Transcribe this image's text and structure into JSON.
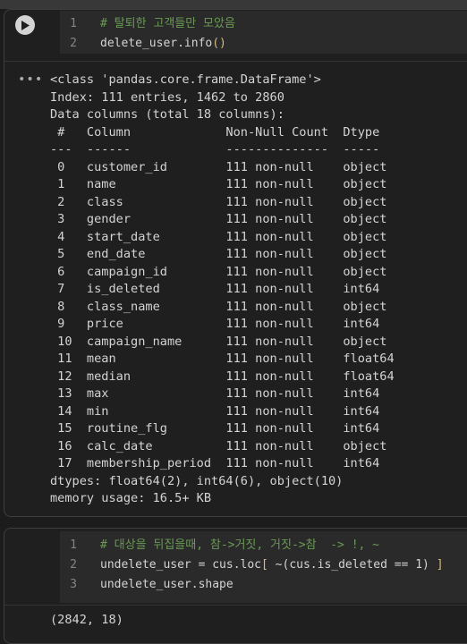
{
  "cell1": {
    "code_lines": [
      {
        "num": "1",
        "text": "# 탈퇴한 고객들만 모았음"
      },
      {
        "num": "2",
        "text_a": "delete_user.info",
        "text_b": "()"
      }
    ],
    "output_menu": "•••",
    "output_lines": [
      "<class 'pandas.core.frame.DataFrame'>",
      "Index: 111 entries, 1462 to 2860",
      "Data columns (total 18 columns):",
      " #   Column             Non-Null Count  Dtype ",
      "---  ------             --------------  ----- ",
      " 0   customer_id        111 non-null    object",
      " 1   name               111 non-null    object",
      " 2   class              111 non-null    object",
      " 3   gender             111 non-null    object",
      " 4   start_date         111 non-null    object",
      " 5   end_date           111 non-null    object",
      " 6   campaign_id        111 non-null    object",
      " 7   is_deleted         111 non-null    int64 ",
      " 8   class_name         111 non-null    object",
      " 9   price              111 non-null    int64 ",
      " 10  campaign_name      111 non-null    object",
      " 11  mean               111 non-null    float64",
      " 12  median             111 non-null    float64",
      " 13  max                111 non-null    int64 ",
      " 14  min                111 non-null    int64 ",
      " 15  routine_flg        111 non-null    int64 ",
      " 16  calc_date          111 non-null    object",
      " 17  membership_period  111 non-null    int64 ",
      "dtypes: float64(2), int64(6), object(10)",
      "memory usage: 16.5+ KB"
    ]
  },
  "cell2": {
    "code_lines": [
      {
        "num": "1",
        "text": "# 대상을 뒤집을때, 참->거짓, 거짓->참  -> !, ~"
      },
      {
        "num": "2",
        "text_a": "undelete_user = cus.loc",
        "text_b": "[",
        "text_c": " ~(cus.is_deleted == 1) ",
        "text_d": "]"
      },
      {
        "num": "3",
        "text": "undelete_user.shape"
      }
    ],
    "output_partial": "(2842, 18)"
  },
  "icons": {
    "run": "play-icon",
    "menu": "more-horizontal-icon"
  },
  "colors": {
    "comment": "#6a9955",
    "bracket": "#d7ba7d",
    "background": "#1c1c1c"
  }
}
